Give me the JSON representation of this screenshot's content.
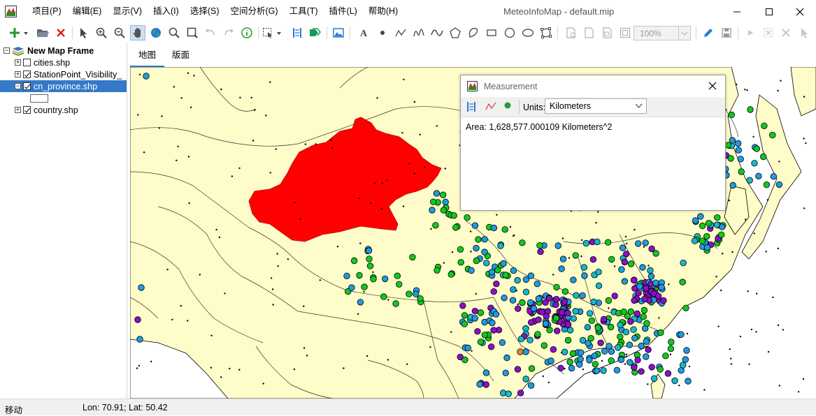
{
  "window": {
    "title": "MeteoInfoMap - default.mip"
  },
  "menu": [
    "项目(P)",
    "编辑(E)",
    "显示(V)",
    "插入(I)",
    "选择(S)",
    "空间分析(G)",
    "工具(T)",
    "插件(L)",
    "帮助(H)"
  ],
  "toolbar": {
    "zoom_value": "100%"
  },
  "layers": {
    "frame": "New Map Frame",
    "items": [
      {
        "name": "cities.shp",
        "checked": false,
        "selected": false
      },
      {
        "name": "StationPoint_Visibility_",
        "checked": true,
        "selected": false
      },
      {
        "name": "cn_province.shp",
        "checked": true,
        "selected": true
      },
      {
        "name": "country.shp",
        "checked": true,
        "selected": false
      }
    ]
  },
  "tabs": [
    "地图",
    "版面"
  ],
  "measurement": {
    "title": "Measurement",
    "units_label": "Units:",
    "units_value": "Kilometers",
    "result": "Area: 1,628,577.000109 Kilometers^2"
  },
  "status": {
    "mode": "移动",
    "coords": "Lon: 70.91; Lat: 50.42"
  },
  "colors": {
    "land": "#fefcc8",
    "selected_region": "#ff0000",
    "station_blue": "#1e9be0",
    "station_green": "#12c820",
    "station_purple": "#8a10c8",
    "station_cyan": "#16b8c8",
    "station_orange": "#f08030"
  },
  "icons": [
    "add-layer-icon",
    "open-folder-icon",
    "remove-icon",
    "select-arrow-icon",
    "zoom-in-icon",
    "zoom-out-icon",
    "pan-hand-icon",
    "globe-icon",
    "magnifier-icon",
    "zoom-box-icon",
    "undo-icon",
    "redo-icon",
    "identify-icon",
    "select-features-icon",
    "measure-icon",
    "label-icon",
    "image-icon",
    "text-icon",
    "point-icon",
    "polyline-icon",
    "freehand-icon",
    "curve-icon",
    "polygon-icon",
    "curve-polygon-icon",
    "rectangle-icon",
    "circle-icon",
    "ellipse-icon",
    "edit-vertices-icon",
    "pencil-icon",
    "save-icon"
  ]
}
